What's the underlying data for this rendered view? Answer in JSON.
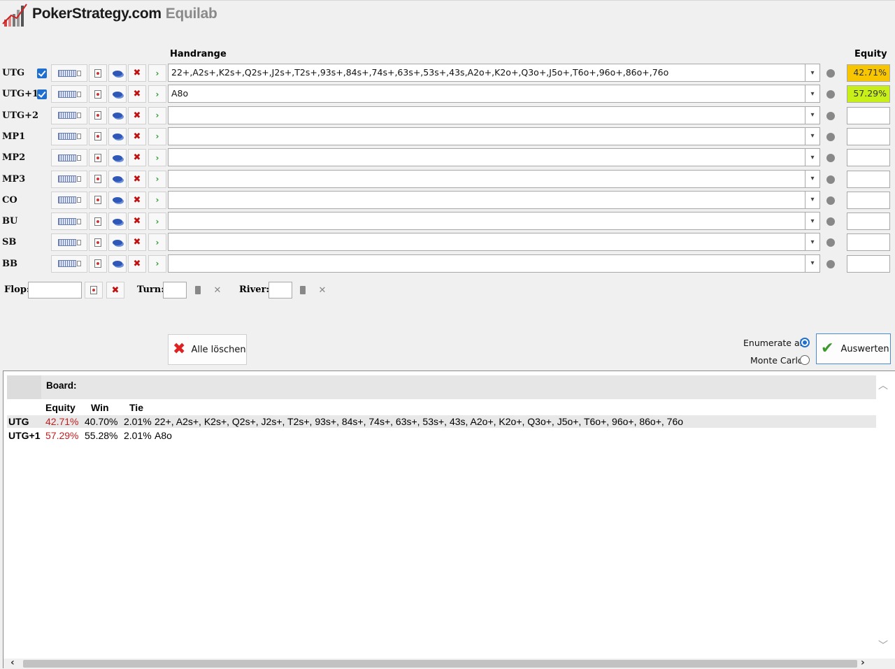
{
  "app": {
    "brand": "PokerStrategy.com",
    "product": "Equilab"
  },
  "headers": {
    "handrange": "Handrange",
    "equity": "Equity"
  },
  "players": [
    {
      "pos": "UTG",
      "checked": true,
      "range": "22+,A2s+,K2s+,Q2s+,J2s+,T2s+,93s+,84s+,74s+,63s+,53s+,43s,A2o+,K2o+,Q3o+,J5o+,T6o+,96o+,86o+,76o",
      "equity": "42.71%",
      "equity_color": "#f7c600"
    },
    {
      "pos": "UTG+1",
      "checked": true,
      "range": "A8o",
      "equity": "57.29%",
      "equity_color": "#c8ef18"
    },
    {
      "pos": "UTG+2",
      "checked": false,
      "range": "",
      "equity": ""
    },
    {
      "pos": "MP1",
      "checked": false,
      "range": "",
      "equity": ""
    },
    {
      "pos": "MP2",
      "checked": false,
      "range": "",
      "equity": ""
    },
    {
      "pos": "MP3",
      "checked": false,
      "range": "",
      "equity": ""
    },
    {
      "pos": "CO",
      "checked": false,
      "range": "",
      "equity": ""
    },
    {
      "pos": "BU",
      "checked": false,
      "range": "",
      "equity": ""
    },
    {
      "pos": "SB",
      "checked": false,
      "range": "",
      "equity": ""
    },
    {
      "pos": "BB",
      "checked": false,
      "range": "",
      "equity": ""
    }
  ],
  "board": {
    "flop_label": "Flop:",
    "turn_label": "Turn:",
    "river_label": "River:"
  },
  "actions": {
    "clear_all": "Alle löschen",
    "evaluate": "Auswerten",
    "enumerate_all": "Enumerate all",
    "monte_carlo": "Monte Carlo",
    "selected_mode": "enumerate"
  },
  "results": {
    "board_label": "Board:",
    "col_equity": "Equity",
    "col_win": "Win",
    "col_tie": "Tie",
    "rows": [
      {
        "pos": "UTG",
        "equity": "42.71%",
        "win": "40.70%",
        "tie": "2.01%",
        "hand": "22+, A2s+, K2s+, Q2s+, J2s+, T2s+, 93s+, 84s+, 74s+, 63s+, 53s+, 43s, A2o+, K2o+, Q3o+, J5o+, T6o+, 96o+, 86o+, 76o"
      },
      {
        "pos": "UTG+1",
        "equity": "57.29%",
        "win": "55.28%",
        "tie": "2.01%",
        "hand": "A8o"
      }
    ]
  }
}
